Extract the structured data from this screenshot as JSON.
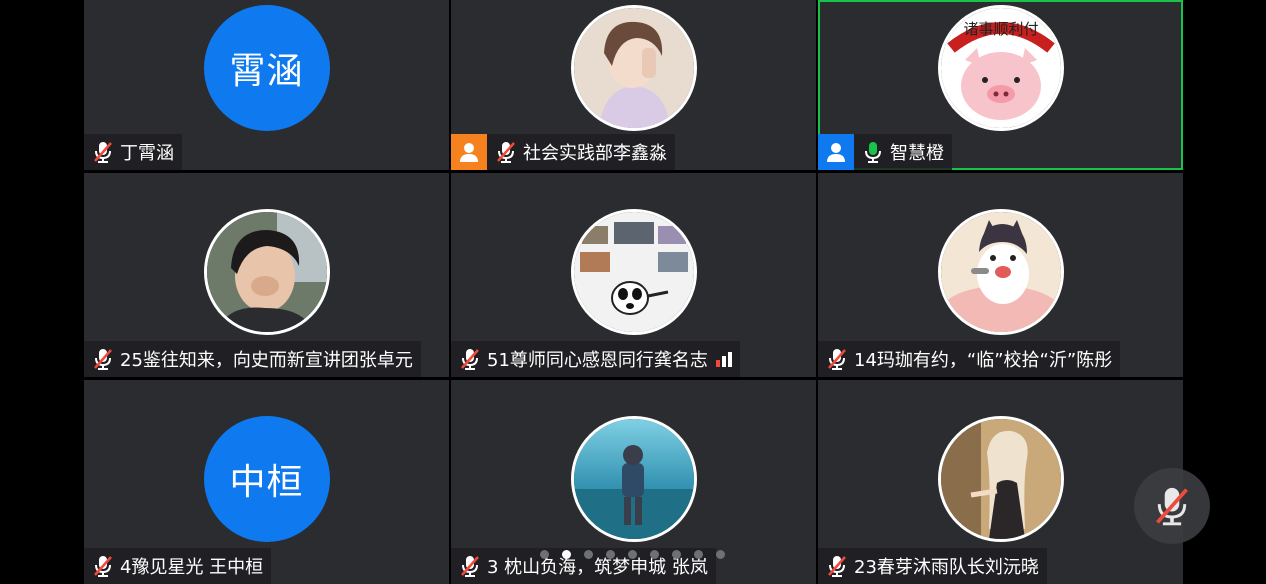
{
  "participants": [
    {
      "name": "丁霄涵",
      "avatar_text": "霄涵",
      "avatar_type": "text",
      "mic": "muted",
      "host_badge": ""
    },
    {
      "name": "社会实践部李鑫淼",
      "avatar_type": "photo",
      "avatar_desc": "anime-boy",
      "mic": "muted",
      "host_badge": "orange"
    },
    {
      "name": "智慧橙",
      "avatar_type": "photo",
      "avatar_desc": "pig-cartoon",
      "mic": "active",
      "host_badge": "blue",
      "avatar_caption": "诸事顺利付"
    },
    {
      "name": "25鉴往知来，向史而新宣讲团张卓元",
      "avatar_type": "photo",
      "avatar_desc": "young-man",
      "mic": "muted",
      "host_badge": ""
    },
    {
      "name": "51尊师同心感恩同行龚名志",
      "avatar_type": "photo",
      "avatar_desc": "panda-meme",
      "mic": "muted",
      "host_badge": "",
      "signal": true
    },
    {
      "name": "14玛珈有约，“临”校拾“沂”陈彤",
      "avatar_type": "photo",
      "avatar_desc": "shiba-cartoon",
      "mic": "muted",
      "host_badge": ""
    },
    {
      "name": "4豫见星光 王中桓",
      "avatar_text": "中桓",
      "avatar_type": "text",
      "mic": "muted",
      "host_badge": ""
    },
    {
      "name": "3 枕山负海，筑梦申城 张岚",
      "avatar_type": "photo",
      "avatar_desc": "boy-by-sea",
      "mic": "muted",
      "host_badge": ""
    },
    {
      "name": "23春芽沐雨队长刘沅晓",
      "avatar_type": "photo",
      "avatar_desc": "anime-girl",
      "mic": "muted",
      "host_badge": ""
    }
  ],
  "pagination": {
    "total_pages": 9,
    "current_page": 2
  },
  "colors": {
    "tile_bg": "#2b2c2f",
    "avatar_blue": "#0f7aef",
    "host_orange": "#f5811f",
    "active_green": "#19c34a",
    "muted_red": "#f14a3c"
  },
  "floating_mic": {
    "state": "muted",
    "icon": "mic-off-icon"
  }
}
